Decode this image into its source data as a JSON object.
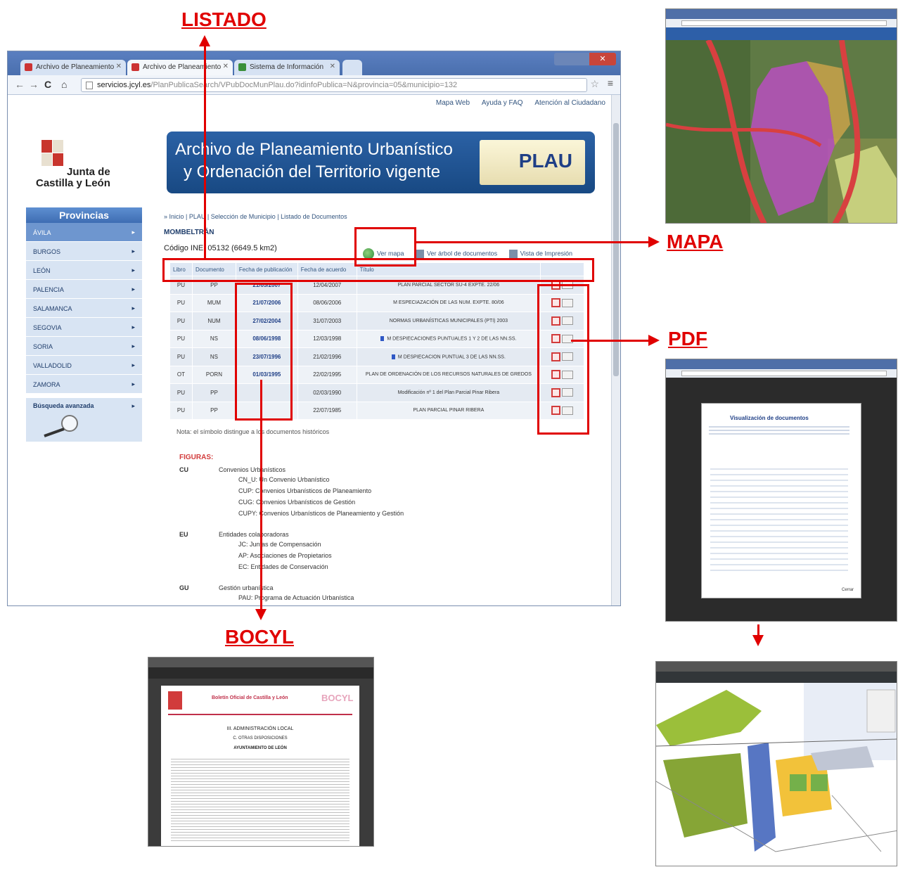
{
  "callouts": {
    "listado": "LISTADO",
    "mapa": "MAPA",
    "pdf": "PDF",
    "bocyl": "BOCYL"
  },
  "browser": {
    "tabs": [
      "Archivo de Planeamiento",
      "Archivo de Planeamiento",
      "Sistema de Información"
    ],
    "url_host": "servicios.jcyl.es",
    "url_path": "/PlanPublicaSearch/VPubDocMunPlau.do?idinfoPublica=N&provincia=05&municipio=132"
  },
  "page": {
    "top_links": [
      "Mapa Web",
      "Ayuda y FAQ",
      "Atención al Ciudadano"
    ],
    "logo_text_1": "Junta de",
    "logo_text_2": "Castilla y León",
    "banner_line1": "Archivo de Planeamiento Urbanístico",
    "banner_line2": "y Ordenación del Territorio vigente",
    "banner_badge": "PLAU",
    "breadcrumb": "» Inicio | PLAU | Selección de Municipio | Listado de Documentos",
    "municipality": "MOMBELTRÁN",
    "ine": "Código INE: 05132 (6649.5 km2)",
    "actions": {
      "map": "Ver mapa",
      "detail": "Ver árbol de documentos",
      "print": "Vista de Impresión"
    }
  },
  "sidebar": {
    "title": "Provincias",
    "items": [
      "ÁVILA",
      "BURGOS",
      "LEÓN",
      "PALENCIA",
      "SALAMANCA",
      "SEGOVIA",
      "SORIA",
      "VALLADOLID",
      "ZAMORA"
    ],
    "advanced_search": "Búsqueda avanzada"
  },
  "table": {
    "headers": [
      "Libro",
      "Documento",
      "Fecha de publicación",
      "Fecha de acuerdo",
      "Título",
      ""
    ],
    "rows": [
      {
        "libro": "PU",
        "doc": "PP",
        "pub": "21/05/2007",
        "acuerdo": "12/04/2007",
        "title": "PLAN PARCIAL SECTOR SU-4 EXPTE. 22/06",
        "hist": false
      },
      {
        "libro": "PU",
        "doc": "MUM",
        "pub": "21/07/2006",
        "acuerdo": "08/06/2006",
        "title": "M ESPECIAZACIÓN DE LAS NUM. EXPTE. 80/06",
        "hist": false
      },
      {
        "libro": "PU",
        "doc": "NUM",
        "pub": "27/02/2004",
        "acuerdo": "31/07/2003",
        "title": "NORMAS URBANÍSTICAS MUNICIPALES (PTI) 2003",
        "hist": false
      },
      {
        "libro": "PU",
        "doc": "NS",
        "pub": "08/06/1998",
        "acuerdo": "12/03/1998",
        "title": "M DESPIECACIONES PUNTUALES 1 Y 2 DE LAS NN.SS.",
        "hist": true
      },
      {
        "libro": "PU",
        "doc": "NS",
        "pub": "23/07/1996",
        "acuerdo": "21/02/1996",
        "title": "M DESPIECACION PUNTUAL 3 DE LAS NN.SS.",
        "hist": true
      },
      {
        "libro": "OT",
        "doc": "PORN",
        "pub": "01/03/1995",
        "acuerdo": "22/02/1995",
        "title": "PLAN DE ORDENACIÓN DE LOS RECURSOS NATURALES DE GREDOS",
        "hist": false
      },
      {
        "libro": "PU",
        "doc": "PP",
        "pub": "",
        "acuerdo": "02/03/1990",
        "title": "Modificación nº 1 del Plan Parcial Pinar Ribera",
        "hist": false
      },
      {
        "libro": "PU",
        "doc": "PP",
        "pub": "",
        "acuerdo": "22/07/1985",
        "title": "PLAN PARCIAL PINAR RIBERA",
        "hist": false
      }
    ]
  },
  "note": "Nota: el símbolo  distingue a los documentos históricos",
  "figuras": {
    "heading": "FIGURAS:",
    "cu_code": "CU",
    "cu_title": "Convenios Urbanísticos",
    "cu_items": [
      "CN_U: Un Convenio Urbanístico",
      "CUP: Convenios Urbanísticos de Planeamiento",
      "CUG: Convenios Urbanísticos de Gestión",
      "CUPY: Convenios Urbanísticos de Planeamiento y Gestión"
    ],
    "eu_code": "EU",
    "eu_title": "Entidades colaboradoras",
    "eu_items": [
      "JC: Juntas de Compensación",
      "AP: Asociaciones de Propietarios",
      "EC: Entidades de Conservación"
    ],
    "gu_code": "GU",
    "gu_title": "Gestión urbanística",
    "gu_items": [
      "PAU: Programa de Actuación Urbanística"
    ]
  },
  "bocyl_doc": {
    "header": "Boletín Oficial de Castilla y León",
    "brand": "BOCYL",
    "section": "III. ADMINISTRACIÓN LOCAL",
    "subsection": "C. OTRAS DISPOSICIONES",
    "entity": "AYUNTAMIENTO DE LEÓN"
  },
  "pdf_dialog": {
    "title": "Visualización de documentos",
    "button": "Cerrar"
  },
  "colors": {
    "accent_red": "#e00000",
    "banner_blue": "#184983",
    "sidebar_blue": "#6e96cf"
  }
}
